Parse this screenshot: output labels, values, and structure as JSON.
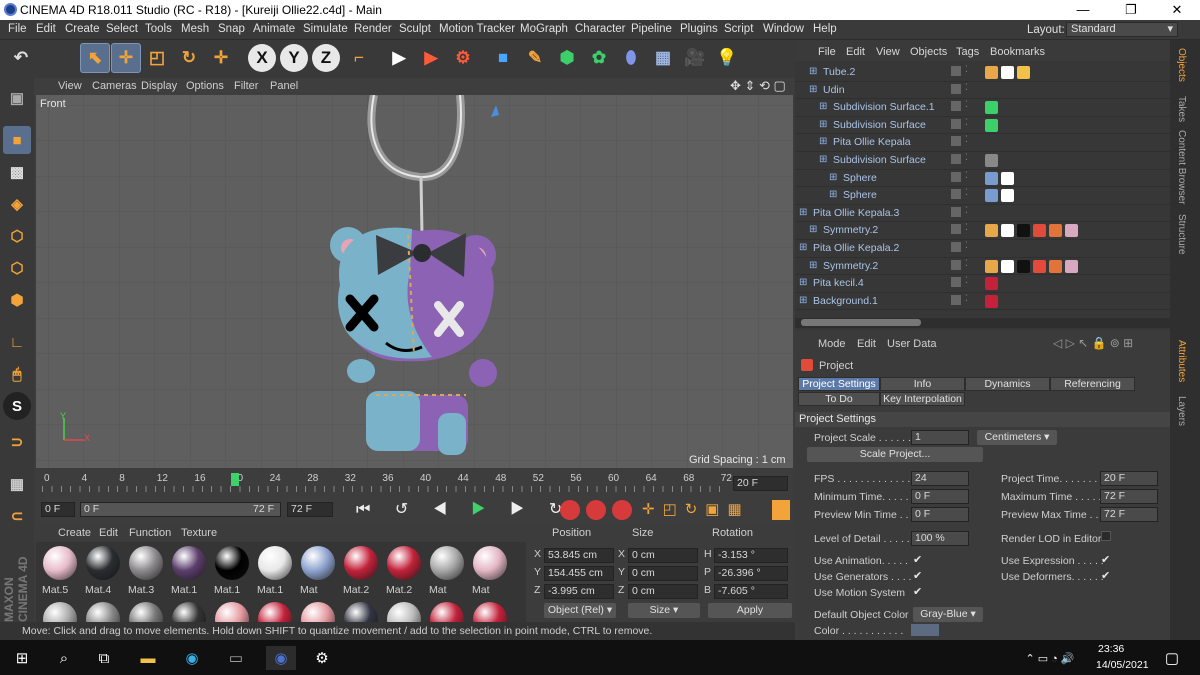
{
  "window": {
    "title": "CINEMA 4D R18.011 Studio (RC - R18) - [Kureiji Ollie22.c4d] - Main",
    "controls": [
      "—",
      "❐",
      "✕"
    ]
  },
  "menu": [
    "File",
    "Edit",
    "Create",
    "Select",
    "Tools",
    "Mesh",
    "Snap",
    "Animate",
    "Simulate",
    "Render",
    "Sculpt",
    "Motion Tracker",
    "MoGraph",
    "Character",
    "Pipeline",
    "Plugins",
    "Script",
    "Window",
    "Help"
  ],
  "layout": {
    "label": "Layout:",
    "value": "Standard"
  },
  "toolbar": [
    "undo-icon",
    "pointer-icon",
    "move-icon",
    "scale-icon",
    "rotate-icon",
    "live-select-icon",
    "X",
    "Y",
    "Z",
    "coordinate-system-icon",
    "render-view-icon",
    "render-picture-queue-icon",
    "edit-render-settings-icon",
    "cube-icon",
    "pen-icon",
    "subdivision-icon",
    "array-icon",
    "deformer-icon",
    "floor-icon",
    "camera-icon",
    "light-icon"
  ],
  "viewport": {
    "menu": [
      "View",
      "Cameras",
      "Display",
      "Options",
      "Filter",
      "Panel"
    ],
    "name": "Front",
    "grid_spacing": "Grid Spacing : 1 cm",
    "axis_y": "Y",
    "axis_x": "X"
  },
  "timeline": {
    "ticks": [
      "0",
      "4",
      "8",
      "12",
      "16",
      "20",
      "24",
      "28",
      "32",
      "36",
      "40",
      "44",
      "48",
      "52",
      "56",
      "60",
      "64",
      "68",
      "72"
    ],
    "current": "20 F",
    "start": "0 F",
    "range_start": "0 F",
    "range_end": "72 F",
    "end": "72 F"
  },
  "materials": {
    "menu": [
      "Create",
      "Edit",
      "Function",
      "Texture"
    ],
    "items": [
      {
        "name": "Mat.5",
        "color": "#e7bccb"
      },
      {
        "name": "Mat.4",
        "color": "#2a2d31"
      },
      {
        "name": "Mat.3",
        "color": "#8d8a8e"
      },
      {
        "name": "Mat.1",
        "color": "#5c3e6c"
      },
      {
        "name": "Mat.1",
        "color": "#000000"
      },
      {
        "name": "Mat.1",
        "color": "#e8e8e8"
      },
      {
        "name": "Mat",
        "color": "#8fa4cf"
      },
      {
        "name": "Mat.2",
        "color": "#c3223a"
      },
      {
        "name": "Mat.2",
        "color": "#c3223a"
      },
      {
        "name": "Mat",
        "color": "#a8a8a8"
      },
      {
        "name": "Mat",
        "color": "#e3b6c4"
      }
    ]
  },
  "coords": {
    "headers": [
      "Position",
      "Size",
      "Rotation"
    ],
    "rows": [
      {
        "axis": "X",
        "pos": "53.845 cm",
        "size_axis": "X",
        "size": "0 cm",
        "rot_axis": "H",
        "rot": "-3.153 °"
      },
      {
        "axis": "Y",
        "pos": "154.455 cm",
        "size_axis": "Y",
        "size": "0 cm",
        "rot_axis": "P",
        "rot": "-26.396 °"
      },
      {
        "axis": "Z",
        "pos": "-3.995 cm",
        "size_axis": "Z",
        "size": "0 cm",
        "rot_axis": "B",
        "rot": "-7.605 °"
      }
    ],
    "mode": "Object (Rel)",
    "size_mode": "Size",
    "apply": "Apply"
  },
  "status": "Move: Click and drag to move elements. Hold down SHIFT to quantize movement / add to the selection in point mode, CTRL to remove.",
  "objects": {
    "menu": [
      "File",
      "Edit",
      "View",
      "Objects",
      "Tags",
      "Bookmarks"
    ],
    "items": [
      {
        "name": "Tube.2",
        "indent": 1
      },
      {
        "name": "Udin",
        "indent": 1
      },
      {
        "name": "Subdivision Surface.1",
        "indent": 2
      },
      {
        "name": "Subdivision Surface",
        "indent": 2
      },
      {
        "name": "Pita Ollie Kepala",
        "indent": 2
      },
      {
        "name": "Subdivision Surface",
        "indent": 2
      },
      {
        "name": "Sphere",
        "indent": 3
      },
      {
        "name": "Sphere",
        "indent": 3
      },
      {
        "name": "Pita Ollie Kepala.3",
        "indent": 0
      },
      {
        "name": "Symmetry.2",
        "indent": 1
      },
      {
        "name": "Pita Ollie Kepala.2",
        "indent": 0
      },
      {
        "name": "Symmetry.2",
        "indent": 1
      },
      {
        "name": "Pita kecil.4",
        "indent": 0
      },
      {
        "name": "Background.1",
        "indent": 0
      }
    ]
  },
  "attributes": {
    "menu": [
      "Mode",
      "Edit",
      "User Data"
    ],
    "title": "Project",
    "tabs": [
      "Project Settings",
      "Info",
      "Dynamics",
      "Referencing",
      "To Do",
      "Key Interpolation"
    ],
    "section": "Project Settings",
    "project_scale_label": "Project Scale . . . . . .",
    "project_scale": "1",
    "scale_unit": "Centimeters",
    "scale_project": "Scale Project...",
    "fps_label": "FPS . . . . . . . . . . . . . . .",
    "fps": "24",
    "project_time_label": "Project Time. . . . . . . .",
    "project_time": "20 F",
    "min_time_label": "Minimum Time. . . . .",
    "min_time": "0 F",
    "max_time_label": "Maximum Time . . . . .",
    "max_time": "72 F",
    "prev_min_label": "Preview Min Time . .",
    "prev_min": "0 F",
    "prev_max_label": "Preview Max Time . . .",
    "prev_max": "72 F",
    "lod_label": "Level of Detail . . . . .",
    "lod": "100 %",
    "render_lod_label": "Render LOD in Editor",
    "use_anim": "Use Animation. . . . .",
    "use_expr": "Use Expression . . . . .",
    "use_gen": "Use Generators . . . .",
    "use_def": "Use Deformers. . . . . .",
    "use_motion": "Use Motion System",
    "def_color_label": "Default Object Color",
    "def_color": "Gray-Blue",
    "color_label": "Color . . . . . . . . . . ."
  },
  "right_tabs": [
    "Objects",
    "Takes",
    "Content Browser",
    "Structure",
    "Attributes",
    "Layers"
  ],
  "taskbar": {
    "time": "23:36",
    "date": "14/05/2021"
  }
}
